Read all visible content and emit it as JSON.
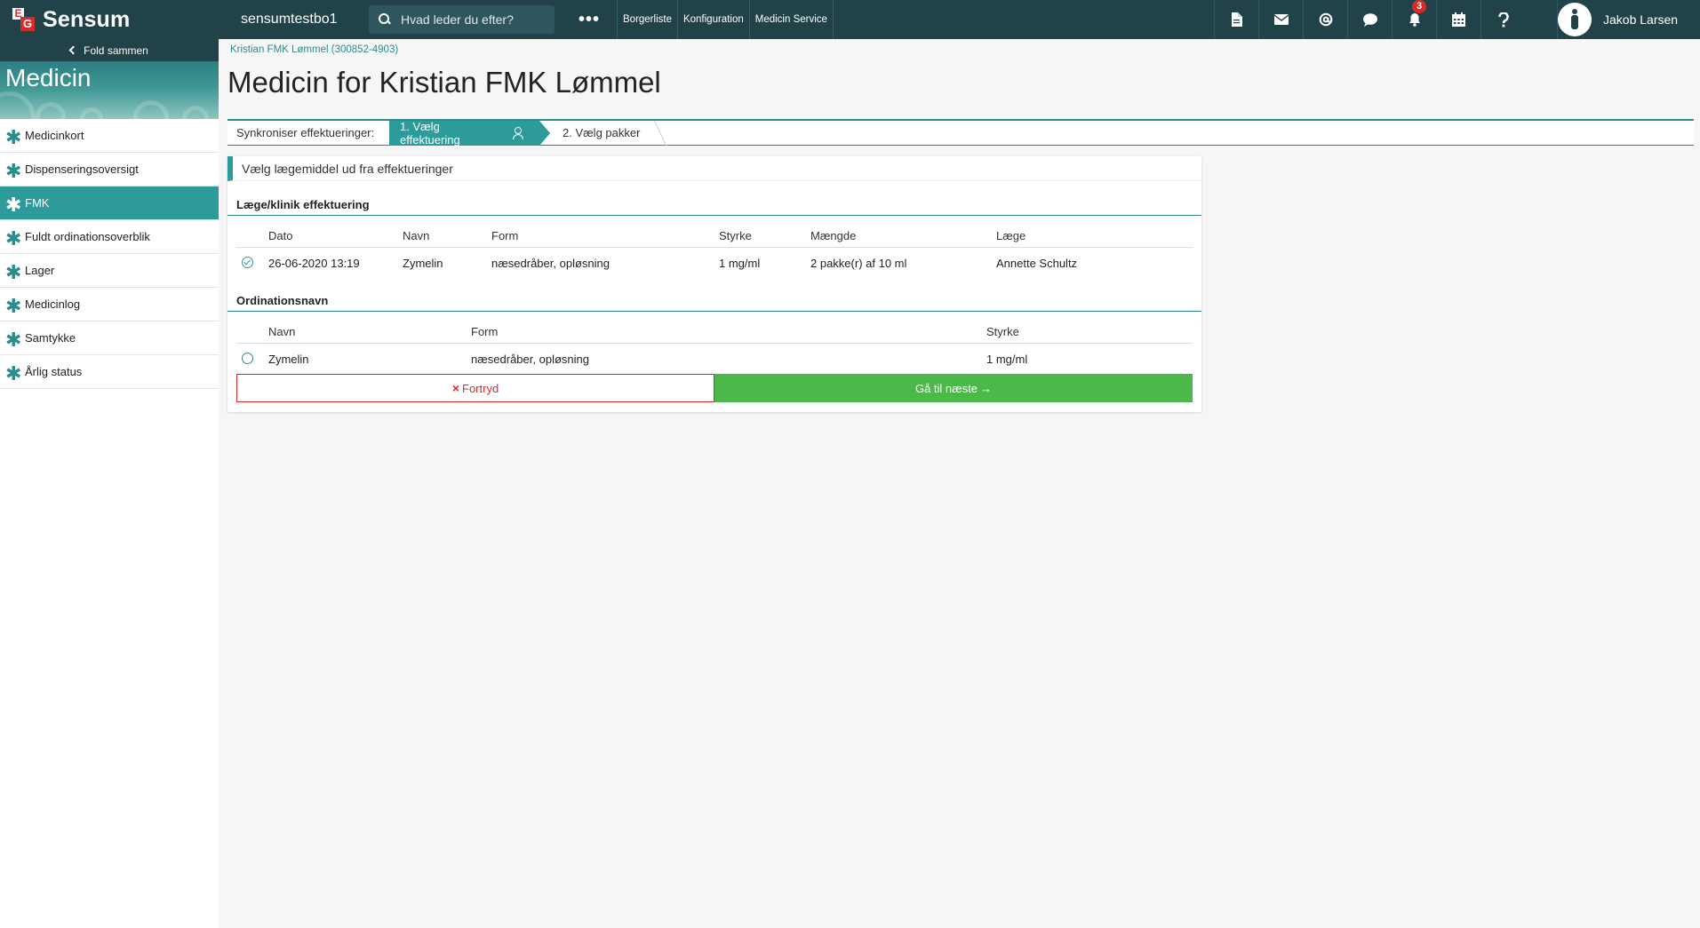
{
  "topbar": {
    "brand_e": "E",
    "brand_g": "G",
    "brand_name": "Sensum",
    "tenant": "sensumtestbo1",
    "search_placeholder": "Hvad leder du efter?",
    "more": "•••",
    "nav": [
      "Borgerliste",
      "Konfiguration",
      "Medicin Service"
    ],
    "icons": [
      "document-icon",
      "mail-icon",
      "at-icon",
      "chat-icon",
      "bell-icon",
      "calendar-icon",
      "help-icon"
    ],
    "notification_count": "3",
    "user_name": "Jakob Larsen"
  },
  "sidebar": {
    "collapse_label": "Fold sammen",
    "module_title": "Medicin",
    "items": [
      {
        "label": "Medicinkort",
        "active": false
      },
      {
        "label": "Dispenseringsoversigt",
        "active": false
      },
      {
        "label": "FMK",
        "active": true
      },
      {
        "label": "Fuldt ordinationsoverblik",
        "active": false
      },
      {
        "label": "Lager",
        "active": false
      },
      {
        "label": "Medicinlog",
        "active": false
      },
      {
        "label": "Samtykke",
        "active": false
      },
      {
        "label": "Årlig status",
        "active": false
      }
    ]
  },
  "main": {
    "breadcrumb": "Kristian FMK Lømmel (300852-4903)",
    "title": "Medicin for Kristian FMK Lømmel",
    "wizard": {
      "label": "Synkroniser effektueringer:",
      "step1": "1. Vælg effektuering",
      "step2": "2. Vælg pakker"
    },
    "panel": {
      "header": "Vælg lægemiddel ud fra effektueringer",
      "effektuering": {
        "title": "Læge/klinik effektuering",
        "columns": [
          "Dato",
          "Navn",
          "Form",
          "Styrke",
          "Mængde",
          "Læge"
        ],
        "row": [
          "26-06-2020 13:19",
          "Zymelin",
          "næsedråber, opløsning",
          "1 mg/ml",
          "2 pakke(r) af 10 ml",
          "Annette Schultz"
        ]
      },
      "ordination": {
        "title": "Ordinationsnavn",
        "columns": [
          "Navn",
          "Form",
          "Styrke"
        ],
        "row": [
          "Zymelin",
          "næsedråber, opløsning",
          "1 mg/ml"
        ]
      },
      "cancel_label": "Fortryd",
      "cancel_icon": "×",
      "next_label": "Gå til næste",
      "next_icon": "→"
    }
  },
  "colors": {
    "topbar": "#214249",
    "accent": "#2e9b9b",
    "danger": "#d72b28",
    "success": "#4cb84a"
  }
}
